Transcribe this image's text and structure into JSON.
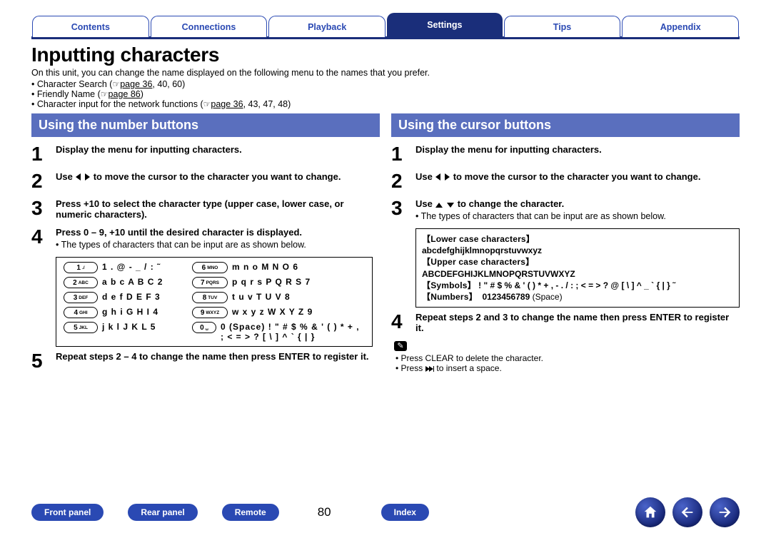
{
  "tabs": {
    "contents": "Contents",
    "connections": "Connections",
    "playback": "Playback",
    "settings": "Settings",
    "tips": "Tips",
    "appendix": "Appendix",
    "active": "settings"
  },
  "page": {
    "title": "Inputting characters",
    "intro": "On this unit, you can change the name displayed on the following menu to the names that you prefer.",
    "pointer": "☞",
    "bullets": {
      "char_search_pre": "Character Search (",
      "char_search_page_label": "page 36",
      "char_search_rest": ", 40, 60)",
      "friendly_name_pre": "Friendly Name (",
      "friendly_name_page_label": "page 86",
      "friendly_name_rest": ")",
      "net_functions_pre": "Character input for the network functions (",
      "net_functions_page_label": "page 36",
      "net_functions_rest": ", 43, 47, 48)"
    }
  },
  "left": {
    "header": "Using the number buttons",
    "step1": "Display the menu for inputting characters.",
    "step2_pre": "Use ",
    "step2_post": " to move the cursor to the character you want to change.",
    "step3": "Press +10 to select the character type (upper case, lower case, or numeric characters).",
    "step4_main": "Press 0 – 9, +10 until the desired character is displayed.",
    "step4_sub": "The types of characters that can be input are as shown below.",
    "keypad": {
      "k1": {
        "num": "1",
        "sub": "./",
        "chars": "1 . @ - _ / : ˜"
      },
      "k2": {
        "num": "2",
        "sub": "ABC",
        "chars": "a b c A B C 2"
      },
      "k3": {
        "num": "3",
        "sub": "DEF",
        "chars": "d e f D E F 3"
      },
      "k4": {
        "num": "4",
        "sub": "GHI",
        "chars": "g h i G H I 4"
      },
      "k5": {
        "num": "5",
        "sub": "JKL",
        "chars": "j k l J K L 5"
      },
      "k6": {
        "num": "6",
        "sub": "MNO",
        "chars": "m n o M N O 6"
      },
      "k7": {
        "num": "7",
        "sub": "PQRS",
        "chars": "p q r s P Q R S 7"
      },
      "k8": {
        "num": "8",
        "sub": "TUV",
        "chars": "t u v T U V 8"
      },
      "k9": {
        "num": "9",
        "sub": "WXYZ",
        "chars": "w x y z W X Y Z 9"
      },
      "k0": {
        "num": "0",
        "sub": "␣",
        "chars_line1": "0 (Space) ! \" # $ % & ' ( ) * + ,",
        "chars_line2": "; < = > ? [ \\ ] ^ ` { | }"
      }
    },
    "step5": "Repeat steps 2 – 4 to change the name then press ENTER to register it."
  },
  "right": {
    "header": "Using the cursor buttons",
    "step1": "Display the menu for inputting characters.",
    "step2_pre": "Use ",
    "step2_post": " to move the cursor to the character you want to change.",
    "step3_main_pre": "Use ",
    "step3_main_post": " to change the character.",
    "step3_sub": "The types of characters that can be input are as shown below.",
    "charbox": {
      "lower_lbl": "【Lower case characters】",
      "lower_chars": "abcdefghijklmnopqrstuvwxyz",
      "upper_lbl": "【Upper case characters】",
      "upper_chars": "ABCDEFGHIJKLMNOPQRSTUVWXYZ",
      "symbols_lbl": "【Symbols】",
      "symbols_chars": " ! \" # $ % & ' ( ) * + , - . / : ; < = > ? @ [ \\ ] ^ _ ` { | } ˜",
      "numbers_lbl": "【Numbers】",
      "numbers_chars": "0123456789 ",
      "space": "(Space)"
    },
    "step4": "Repeat steps 2 and 3 to change the name then press ENTER to register it.",
    "hint_icon": "✎",
    "hint1": "Press CLEAR to delete the character.",
    "hint2_pre": "Press ",
    "hint2_post": " to insert a space."
  },
  "footer": {
    "front_panel": "Front panel",
    "rear_panel": "Rear panel",
    "remote": "Remote",
    "page_num": "80",
    "index": "Index"
  }
}
